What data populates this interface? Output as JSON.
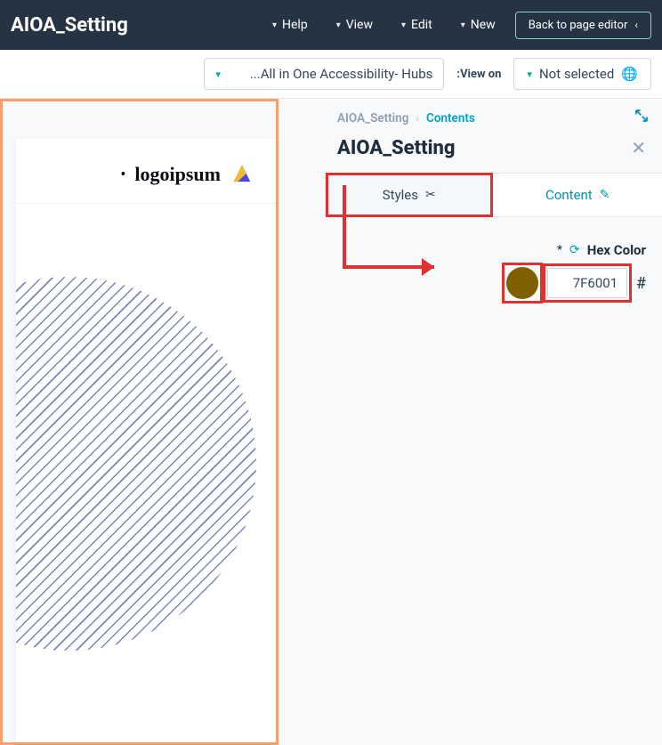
{
  "header": {
    "back_label": "Back to page editor",
    "menu": {
      "new": "New",
      "edit": "Edit",
      "view": "View",
      "help": "Help"
    },
    "title": "AIOA_Setting"
  },
  "toolbar": {
    "not_selected_label": "Not selected",
    "view_on_label": "View on:",
    "view_on_value": "All in One Accessibility- Hubs..."
  },
  "inspector": {
    "crumbs": {
      "contents": "Contents",
      "current": "AIOA_Setting"
    },
    "panel_title": "AIOA_Setting",
    "tabs": {
      "content": "Content",
      "styles": "Styles"
    },
    "field": {
      "label": "Hex Color",
      "value": "7F6001",
      "hash": "#"
    }
  },
  "preview": {
    "logo_text": "logoipsum",
    "logo_dot": "•"
  }
}
